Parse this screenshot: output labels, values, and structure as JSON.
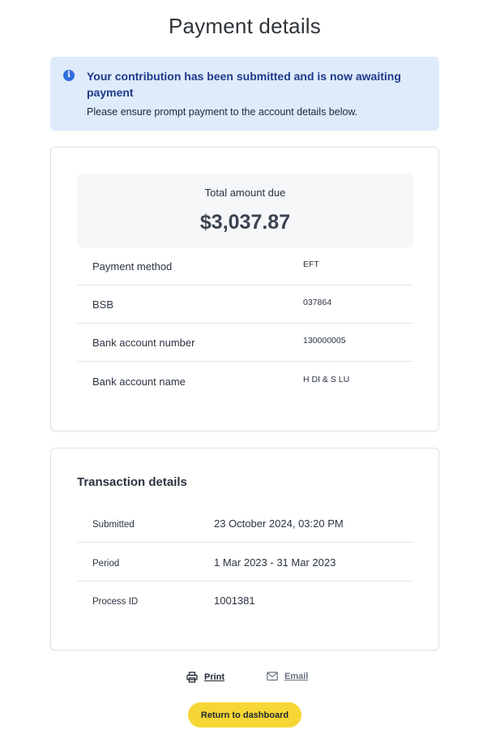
{
  "page": {
    "title": "Payment details"
  },
  "alert": {
    "title": "Your contribution has been submitted and is now awaiting payment",
    "message": "Please ensure prompt payment to the account details below."
  },
  "payment": {
    "total_label": "Total amount due",
    "total_amount": "$3,037.87",
    "rows": [
      {
        "label": "Payment method",
        "value": "EFT"
      },
      {
        "label": "BSB",
        "value": "037864"
      },
      {
        "label": "Bank account number",
        "value": "130000005"
      },
      {
        "label": "Bank account name",
        "value": "H DI & S LU"
      }
    ]
  },
  "transaction": {
    "title": "Transaction details",
    "rows": [
      {
        "label": "Submitted",
        "value": "23 October 2024, 03:20 PM"
      },
      {
        "label": "Period",
        "value": "1 Mar 2023 - 31 Mar 2023"
      },
      {
        "label": "Process ID",
        "value": "1001381"
      }
    ]
  },
  "actions": {
    "print_label": "Print",
    "email_label": "Email"
  },
  "button": {
    "dashboard_label": "Return to dashboard"
  },
  "colors": {
    "accent_yellow": "#f6d635",
    "info_blue": "#2f6fde",
    "alert_bg": "#deebfb"
  },
  "icons": {
    "info": "info-icon",
    "print": "printer-icon",
    "email": "envelope-icon"
  }
}
